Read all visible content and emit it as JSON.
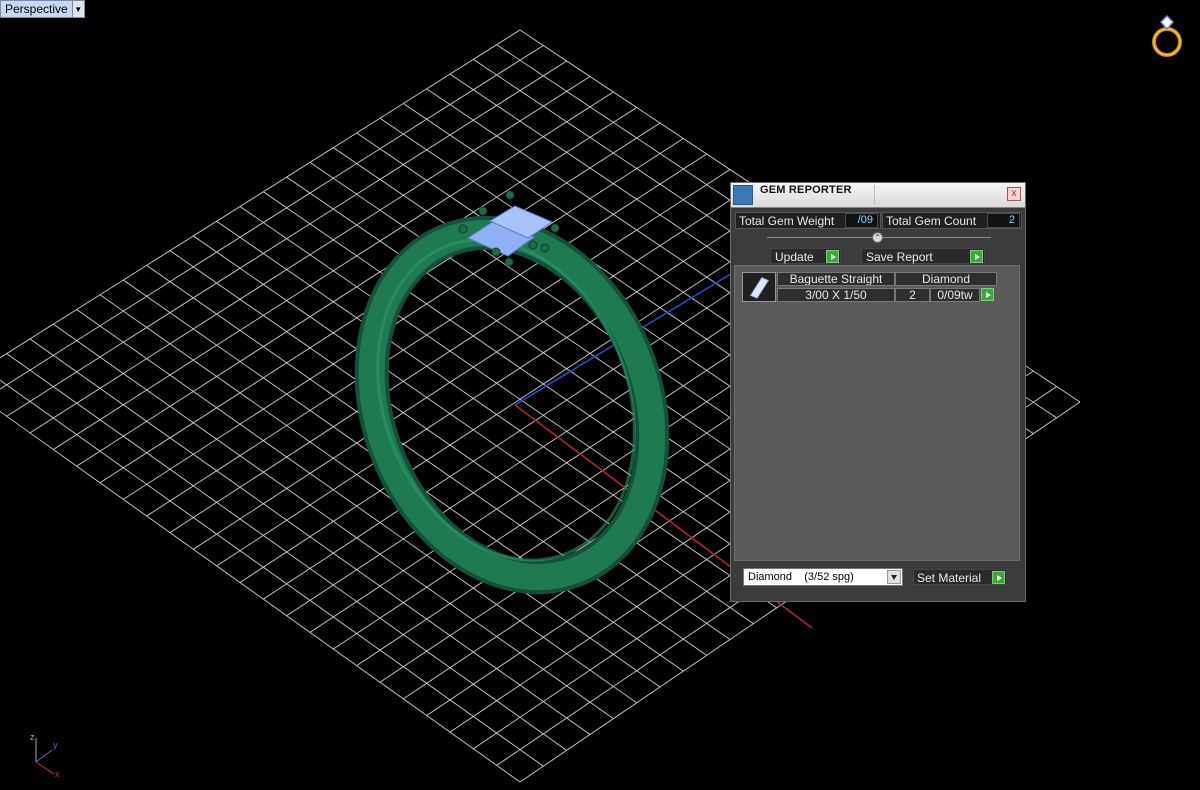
{
  "viewport": {
    "view_label": "Perspective"
  },
  "gem_reporter": {
    "title": "GEM REPORTER",
    "close_glyph": "x",
    "total_weight_label": "Total Gem Weight",
    "total_weight_value": "/09",
    "total_count_label": "Total Gem Count",
    "total_count_value": "2",
    "update_label": "Update",
    "save_report_label": "Save Report",
    "gems": [
      {
        "shape": "Baguette Straight",
        "material": "Diamond",
        "size": "3/00 X 1/50",
        "count": "2",
        "weight": "0/09tw"
      }
    ],
    "material_select_value": "Diamond    (3/52 spg)",
    "set_material_label": "Set Material"
  },
  "colors": {
    "grid": "#d0d0d0",
    "ring": "#1f7a52",
    "gem": "#7ea2f0",
    "panel": "#3b3b3b",
    "value_text": "#66e3ff",
    "go_button": "#3aa83a"
  },
  "icons": [
    "ring-logo-icon",
    "gem-reporter-icon",
    "close-icon",
    "baguette-gem-icon",
    "dropdown-arrow-icon",
    "play-icon",
    "axis-indicator-icon"
  ]
}
